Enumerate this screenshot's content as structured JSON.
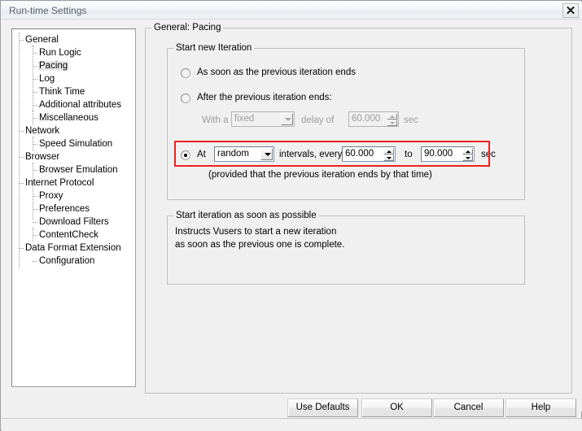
{
  "window": {
    "title": "Run-time Settings",
    "close_glyph": "✕"
  },
  "tree": {
    "items": [
      {
        "label": "General",
        "depth": 0,
        "selected": false
      },
      {
        "label": "Run Logic",
        "depth": 1,
        "selected": false
      },
      {
        "label": "Pacing",
        "depth": 1,
        "selected": true
      },
      {
        "label": "Log",
        "depth": 1,
        "selected": false
      },
      {
        "label": "Think Time",
        "depth": 1,
        "selected": false
      },
      {
        "label": "Additional attributes",
        "depth": 1,
        "selected": false
      },
      {
        "label": "Miscellaneous",
        "depth": 1,
        "selected": false
      },
      {
        "label": "Network",
        "depth": 0,
        "selected": false
      },
      {
        "label": "Speed Simulation",
        "depth": 1,
        "selected": false
      },
      {
        "label": "Browser",
        "depth": 0,
        "selected": false
      },
      {
        "label": "Browser Emulation",
        "depth": 1,
        "selected": false
      },
      {
        "label": "Internet Protocol",
        "depth": 0,
        "selected": false
      },
      {
        "label": "Proxy",
        "depth": 1,
        "selected": false
      },
      {
        "label": "Preferences",
        "depth": 1,
        "selected": false
      },
      {
        "label": "Download Filters",
        "depth": 1,
        "selected": false
      },
      {
        "label": "ContentCheck",
        "depth": 1,
        "selected": false
      },
      {
        "label": "Data Format Extension",
        "depth": 0,
        "selected": false
      },
      {
        "label": "Configuration",
        "depth": 1,
        "selected": false
      }
    ]
  },
  "main": {
    "group_title": "General: Pacing",
    "start_new_iteration": {
      "title": "Start new Iteration",
      "option_immediate": {
        "label": "As soon as the previous iteration ends",
        "checked": false
      },
      "option_after": {
        "label": "After the previous iteration ends:",
        "checked": false,
        "with_a_label": "With a",
        "delay_type": "fixed",
        "delay_of_label": "delay of",
        "delay_value": "60.000",
        "delay_unit": "sec"
      },
      "option_at_intervals": {
        "checked": true,
        "at_label": "At",
        "interval_type": "random",
        "intervals_every_label": "intervals, every",
        "from_value": "60.000",
        "to_label": "to",
        "to_value": "90.000",
        "unit": "sec",
        "note": "(provided that the previous iteration ends by that time)",
        "highlight_color": "#ef2020"
      }
    },
    "description": {
      "title": "Start iteration as soon as possible",
      "line1": "Instructs Vusers to start a new iteration",
      "line2": "as soon as the previous one is complete."
    }
  },
  "buttons": {
    "use_defaults": "Use Defaults",
    "ok": "OK",
    "cancel": "Cancel",
    "help": "Help"
  }
}
